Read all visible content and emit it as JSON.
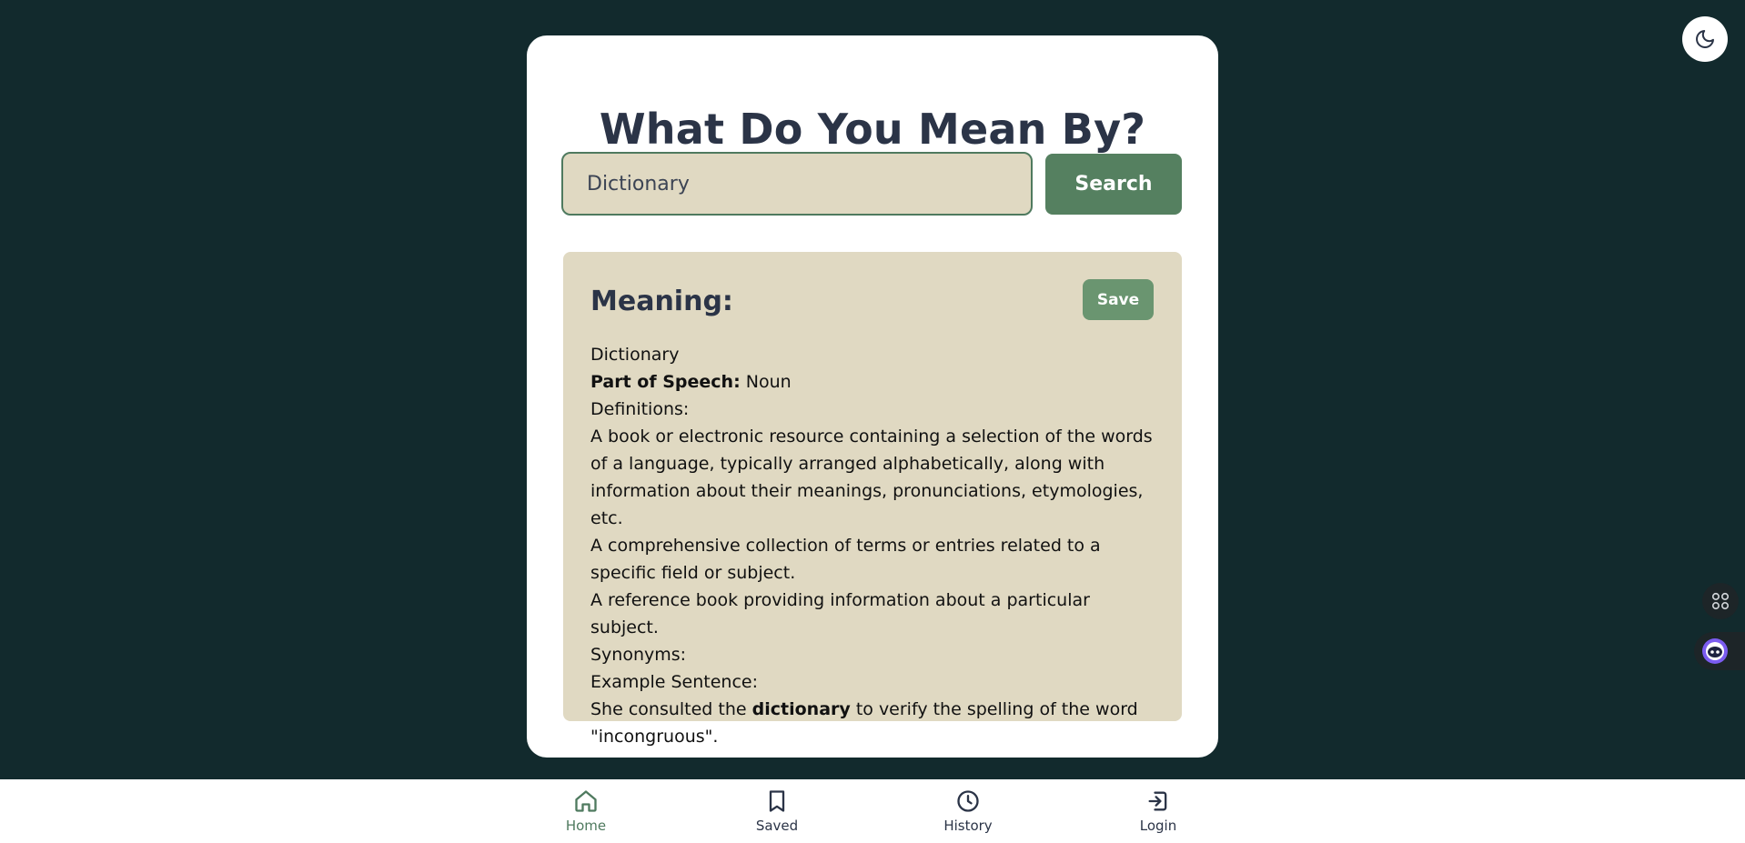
{
  "app": {
    "title": "What Do You Mean By?"
  },
  "search": {
    "value": "Dictionary",
    "button_label": "Search"
  },
  "meaning": {
    "heading": "Meaning:",
    "save_label": "Save",
    "word": "Dictionary",
    "part_of_speech_label": "Part of Speech:",
    "part_of_speech": "Noun",
    "definitions_label": "Definitions:",
    "definitions": [
      "A book or electronic resource containing a selection of the words of a language, typically arranged alphabetically, along with information about their meanings, pronunciations, etymologies, etc.",
      "A comprehensive collection of terms or entries related to a specific field or subject.",
      "A reference book providing information about a particular subject."
    ],
    "synonyms_label": "Synonyms:",
    "example_label": "Example Sentence:",
    "example_before": "She consulted the",
    "example_word": "dictionary",
    "example_after": "to verify the spelling of the word \"incongruous\"."
  },
  "nav": {
    "items": [
      {
        "label": "Home",
        "icon": "home-icon",
        "active": true
      },
      {
        "label": "Saved",
        "icon": "bookmark-icon",
        "active": false
      },
      {
        "label": "History",
        "icon": "clock-icon",
        "active": false
      },
      {
        "label": "Login",
        "icon": "login-icon",
        "active": false
      }
    ]
  },
  "colors": {
    "background": "#122a2d",
    "card": "#ffffff",
    "panel": "#e0d9c2",
    "accent": "#558060",
    "text": "#2b3447"
  },
  "icons": {
    "theme_toggle": "moon-icon",
    "floating_1": "command-icon",
    "floating_2": "assistant-bot-icon"
  }
}
